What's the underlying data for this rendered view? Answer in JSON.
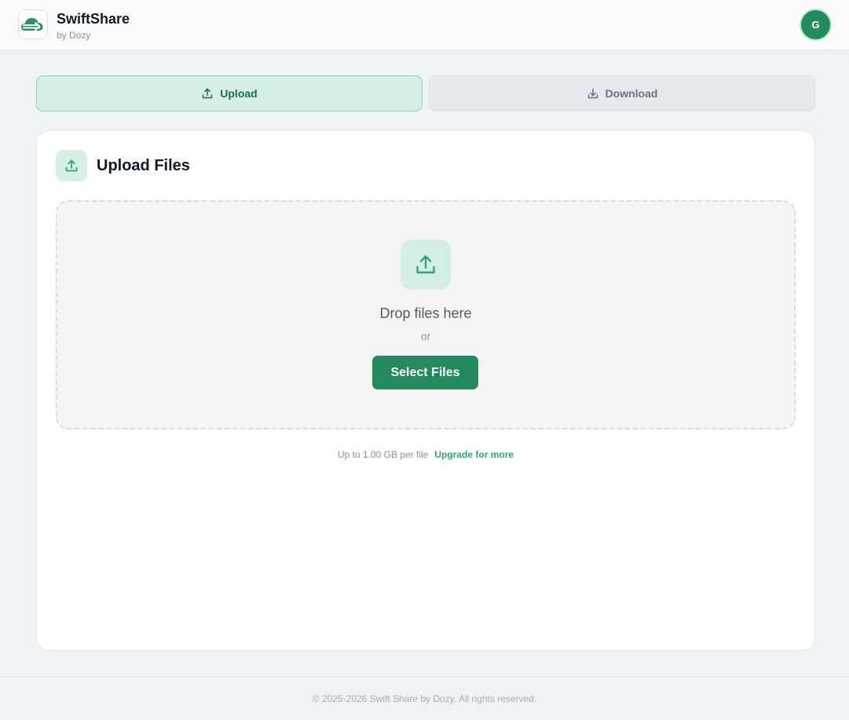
{
  "brand": {
    "name": "SwiftShare",
    "subtitle": "by Dozy",
    "accent_color": "#24895f"
  },
  "user": {
    "avatar_initial": "G"
  },
  "tabs": [
    {
      "label": "Upload",
      "icon": "upload-icon",
      "active": true
    },
    {
      "label": "Download",
      "icon": "download-icon",
      "active": false
    }
  ],
  "card": {
    "title": "Upload Files",
    "icon": "upload-icon",
    "dropzone": {
      "icon": "upload-icon",
      "text": "Drop files here",
      "or_text": "or",
      "button_label": "Select Files"
    },
    "limit_text": "Up to 1.00 GB per file",
    "upgrade_label": "Upgrade for more"
  },
  "footer": {
    "text": "© 2025-2026 Swift Share by Dozy. All rights reserved."
  }
}
